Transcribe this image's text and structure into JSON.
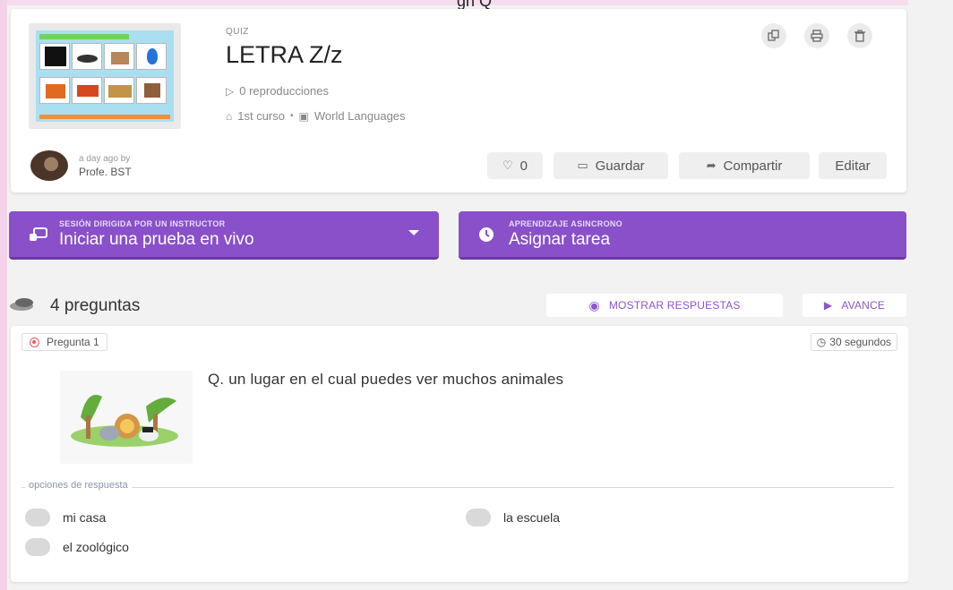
{
  "header_cut": "gn Q",
  "quiz": {
    "type_label": "QUIZ",
    "title": "LETRA Z/z",
    "plays": "0 reproducciones",
    "grade": "1st curso",
    "subject": "World Languages"
  },
  "top_icons": [
    "copy-icon",
    "print-icon",
    "delete-icon"
  ],
  "author": {
    "time": "a day ago by",
    "name": "Profe. BST"
  },
  "actions": {
    "likes": "0",
    "save": "Guardar",
    "share": "Compartir",
    "edit": "Editar"
  },
  "live": {
    "small": "SESIÓN DIRIGIDA POR UN INSTRUCTOR",
    "big": "Iniciar una prueba en vivo"
  },
  "assign": {
    "small": "APRENDIZAJE ASINCRONO",
    "big": "Asignar tarea"
  },
  "question_count": "4 preguntas",
  "show_answers": "MOSTRAR RESPUESTAS",
  "preview": "AVANCE",
  "question": {
    "label": "Pregunta 1",
    "time": "30 segundos",
    "text": "Q. un lugar en el cual puedes ver muchos animales",
    "options_label": "opciones de respuesta",
    "options": [
      "mi casa",
      "la escuela",
      "el zoológico"
    ]
  },
  "colors": {
    "purple": "#8950c9",
    "purple_dark": "#6c39a3",
    "accent_text": "#8b56cc"
  }
}
